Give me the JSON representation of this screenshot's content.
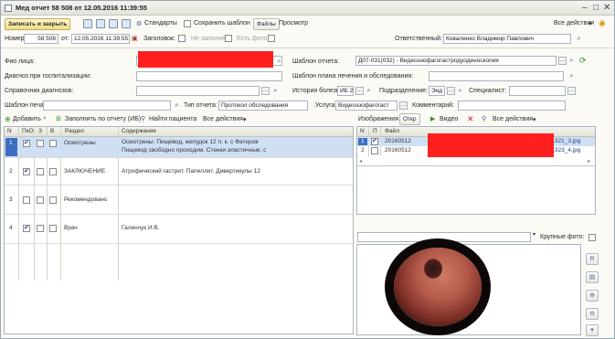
{
  "window": {
    "title": "Мед отчет 58 508 от 12.05.2016 11:39:55"
  },
  "toolbar": {
    "save_close": "Записать и закрыть",
    "standards": "Стандарты",
    "save_template": "Сохранить шаблон",
    "files": "Файлы",
    "preview": "Просмотр",
    "all_actions": "Все действия"
  },
  "header_row": {
    "number_label": "Номер:",
    "number_value": "58 508",
    "date_label": "от:",
    "date_value": "12.05.2016 11:39:55",
    "draft_label": "Заголовок:",
    "not_filled": "Не заполнен",
    "has_photo": "Есть фото",
    "responsible_label": "Ответственный:",
    "responsible_value": "Коваленко Владимир Павлович"
  },
  "form": {
    "fio_label": "Фио лица:",
    "template_label": "Шаблон отчета:",
    "template_value": "Д07-031(032) - Видеоэзофагогастродуоденоскопия",
    "diag_label": "Диагноз при госпитализации:",
    "plan_label": "Шаблон плана лечения и обследования:",
    "ref_diag_label": "Справочник диагнозов:",
    "history_label": "История болезни:",
    "history_value": "ИБ 2",
    "dept_label": "Подразделение:",
    "dept_value": "Энд",
    "spec_label": "Специалист:",
    "print_template_label": "Шаблон печати:",
    "report_type_label": "Тип отчета:",
    "report_type_value": "Протокол обследования",
    "service_label": "Услуга:",
    "service_value": "Видеоэзофагогаст",
    "comment_label": "Комментарий:"
  },
  "grid_toolbar": {
    "add": "Добавить",
    "fill_report": "Заполнить по отчету (ИБ)",
    "find_patient": "Найти пациента",
    "all_actions": "Все действия"
  },
  "grid": {
    "columns": [
      "N",
      "ПкО",
      "З",
      "В",
      "Раздел",
      "Содержание"
    ],
    "rows": [
      {
        "n": "1",
        "pko": true,
        "z": false,
        "v": false,
        "section": "Осмотрены",
        "content": "Осмотрены: Пищевод, желудок 12 п. к. с Фатеров",
        "content2": "Пищевод свободно проходим. Стенки эластичные, с",
        "selected": true
      },
      {
        "n": "2",
        "pko": true,
        "z": false,
        "v": false,
        "section": "ЗАКЛЮЧЕНИЕ",
        "content": "Атрофический гастрит. Папиллит. Дивертикулы 12",
        "selected": false
      },
      {
        "n": "3",
        "pko": false,
        "z": false,
        "v": false,
        "section": "Рекомендовано",
        "content": "",
        "selected": false
      },
      {
        "n": "4",
        "pko": true,
        "z": false,
        "v": false,
        "section": "Врач",
        "content": "Галенчук И.В.",
        "selected": false
      }
    ]
  },
  "files_toolbar": {
    "images": "Изображения",
    "open": "Откр",
    "video": "Видео",
    "all_actions": "Все действия"
  },
  "files": {
    "columns": [
      "N",
      "П",
      "Файл"
    ],
    "rows": [
      {
        "n": "1",
        "checked": true,
        "prefix": "20160512",
        "suffix": "111321_3.jpg",
        "selected": true
      },
      {
        "n": "2",
        "checked": false,
        "prefix": "20160512",
        "suffix": "111323_4.jpg",
        "selected": false
      }
    ],
    "large_photo": "Крупные фото:"
  },
  "colors": {
    "accent": "#f1df82",
    "redaction": "#ff1f1f",
    "selection": "#3c6fc0"
  }
}
